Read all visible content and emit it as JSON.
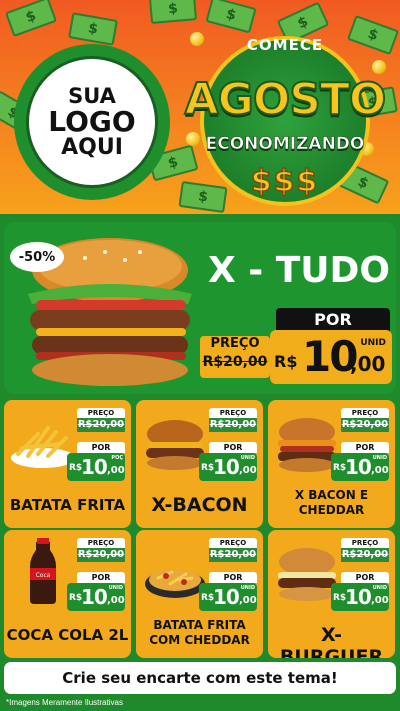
{
  "header": {
    "logo": {
      "line1": "SUA",
      "line2": "LOGO",
      "line3": "AQUI"
    },
    "title": {
      "top": "COMECE",
      "main": "AGOSTO",
      "sub": "ECONOMIZANDO",
      "symbols": "$$$"
    }
  },
  "featured": {
    "discount": "-50%",
    "name": "X - TUDO",
    "price_label": "PREÇO",
    "old_price": "R$20,00",
    "por_label": "POR",
    "currency": "R$",
    "new_price": "10",
    "cents": ",00",
    "unit": "UNID"
  },
  "products": [
    {
      "name": "BATATA FRITA",
      "price_label": "PREÇO",
      "old_price": "R$20,00",
      "por_label": "POR",
      "currency": "R$",
      "price": "10",
      "cents": ",00",
      "unit": "POÇ"
    },
    {
      "name": "X-BACON",
      "price_label": "PREÇO",
      "old_price": "R$20,00",
      "por_label": "POR",
      "currency": "R$",
      "price": "10",
      "cents": ",00",
      "unit": "UNID"
    },
    {
      "name": "X BACON E CHEDDAR",
      "price_label": "PREÇO",
      "old_price": "R$20,00",
      "por_label": "POR",
      "currency": "R$",
      "price": "10",
      "cents": ",00",
      "unit": "UNID"
    },
    {
      "name": "COCA COLA 2L",
      "price_label": "PREÇO",
      "old_price": "R$20,00",
      "por_label": "POR",
      "currency": "R$",
      "price": "10",
      "cents": ",00",
      "unit": "UNID"
    },
    {
      "name": "BATATA FRITA COM CHEDDAR",
      "price_label": "PREÇO",
      "old_price": "R$20,00",
      "por_label": "POR",
      "currency": "R$",
      "price": "10",
      "cents": ",00",
      "unit": "UNID"
    },
    {
      "name": "X-BURGUER",
      "price_label": "PREÇO",
      "old_price": "R$20,00",
      "por_label": "POR",
      "currency": "R$",
      "price": "10",
      "cents": ",00",
      "unit": "UNID"
    }
  ],
  "cta": "Crie seu encarte com este tema!",
  "footnote": "*Imagens Meramente Ilustrativas",
  "colors": {
    "green": "#1f8f2e",
    "orange": "#f2a91b",
    "red_orange": "#f15a22"
  }
}
